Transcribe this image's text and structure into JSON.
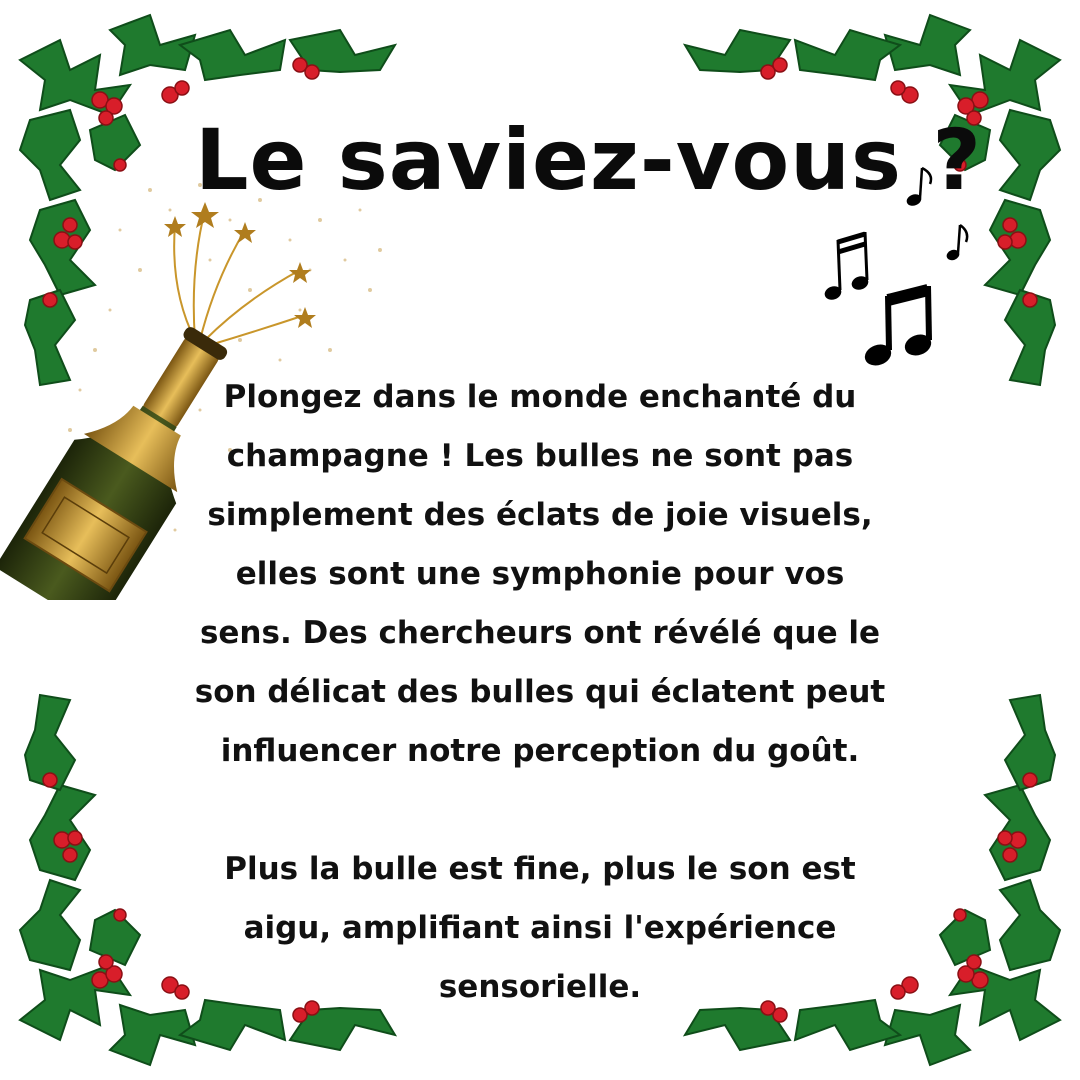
{
  "title": "Le saviez-vous ?",
  "paragraph1": {
    "line1": "Plongez dans le monde enchanté du",
    "line2_bold": "champagne",
    "line2_rest": " ! Les bulles ne sont pas",
    "line3": "simplement des éclats de joie visuels,",
    "line4": "elles sont une symphonie pour vos",
    "line5": "sens. Des chercheurs ont révélé que le",
    "line6": "son délicat des bulles qui éclatent peut",
    "line7": "influencer notre perception du goût."
  },
  "paragraph2": {
    "line1": "Plus la bulle est fine, plus le son est",
    "line2": "aigu, amplifiant ainsi l'expérience",
    "line3": "sensorielle."
  },
  "colors": {
    "background": "#ffffff",
    "text": "#111111",
    "holly_leaf": "#1f7a2e",
    "holly_berry": "#d81e2a",
    "bottle_glass": "#2f3b14",
    "bottle_gold": "#c9962b"
  },
  "decorations": {
    "corner_motif": "holly-branch-icon",
    "left_motif": "champagne-bottle-icon",
    "right_motif": "music-notes-icon"
  }
}
